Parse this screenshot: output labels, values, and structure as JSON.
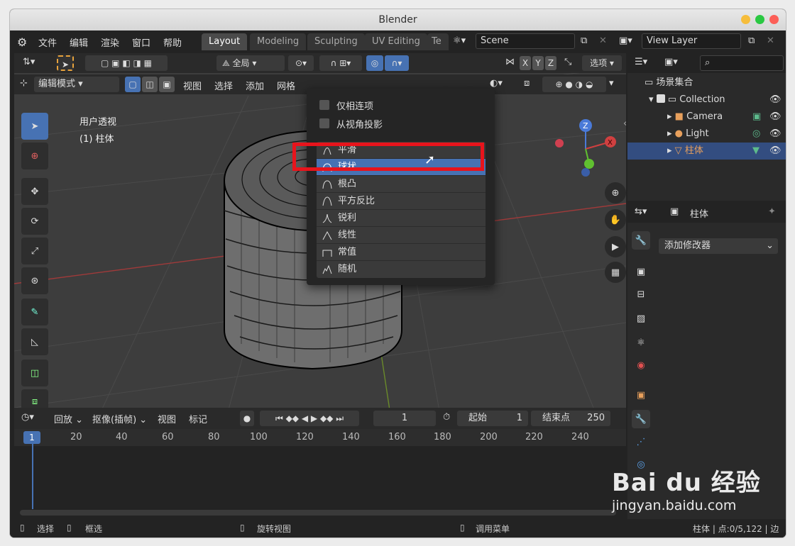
{
  "window": {
    "title": "Blender"
  },
  "menu": [
    "文件",
    "编辑",
    "渲染",
    "窗口",
    "帮助"
  ],
  "workspaces": [
    "Layout",
    "Modeling",
    "Sculpting",
    "UV Editing",
    "Te"
  ],
  "scene": {
    "name": "Scene",
    "view_layer": "View Layer"
  },
  "viewport": {
    "pivot": "全局",
    "options": "选项",
    "axes": [
      "X",
      "Y",
      "Z"
    ],
    "mode": "编辑模式",
    "menus": [
      "视图",
      "选择",
      "添加",
      "网格"
    ],
    "view_name": "用户透视",
    "object_label": "(1) 柱体",
    "gizmo_z": "Z",
    "gizmo_x": "X"
  },
  "popup": {
    "options": [
      "仅相连项",
      "从视角投影"
    ],
    "falloffs": [
      "平滑",
      "球状",
      "根凸",
      "平方反比",
      "锐利",
      "线性",
      "常值",
      "随机"
    ],
    "selected": "球状"
  },
  "outliner": {
    "scene_collection": "场景集合",
    "items": [
      "Collection",
      "Camera",
      "Light",
      "柱体"
    ],
    "selected": "柱体"
  },
  "properties": {
    "object_name": "柱体",
    "add_modifier": "添加修改器"
  },
  "timeline": {
    "playback": "回放",
    "keying": "抠像(插帧)",
    "view": "视图",
    "marker": "标记",
    "current_frame": "1",
    "start_label": "起始",
    "start": "1",
    "end_label": "结束点",
    "end": "250",
    "ticks": [
      "20",
      "40",
      "60",
      "80",
      "100",
      "120",
      "140",
      "160",
      "180",
      "200",
      "220",
      "240"
    ]
  },
  "status": {
    "hints": [
      "选择",
      "框选",
      "旋转视图",
      "调用菜单"
    ],
    "stats": "柱体 | 点:0/5,122 | 边"
  },
  "watermark": {
    "logo": "Bai du 经验",
    "url": "jingyan.baidu.com"
  },
  "colors": {
    "accent": "#4772b3",
    "highlight_box": "#e8141c",
    "background": "#3d3d3d"
  }
}
